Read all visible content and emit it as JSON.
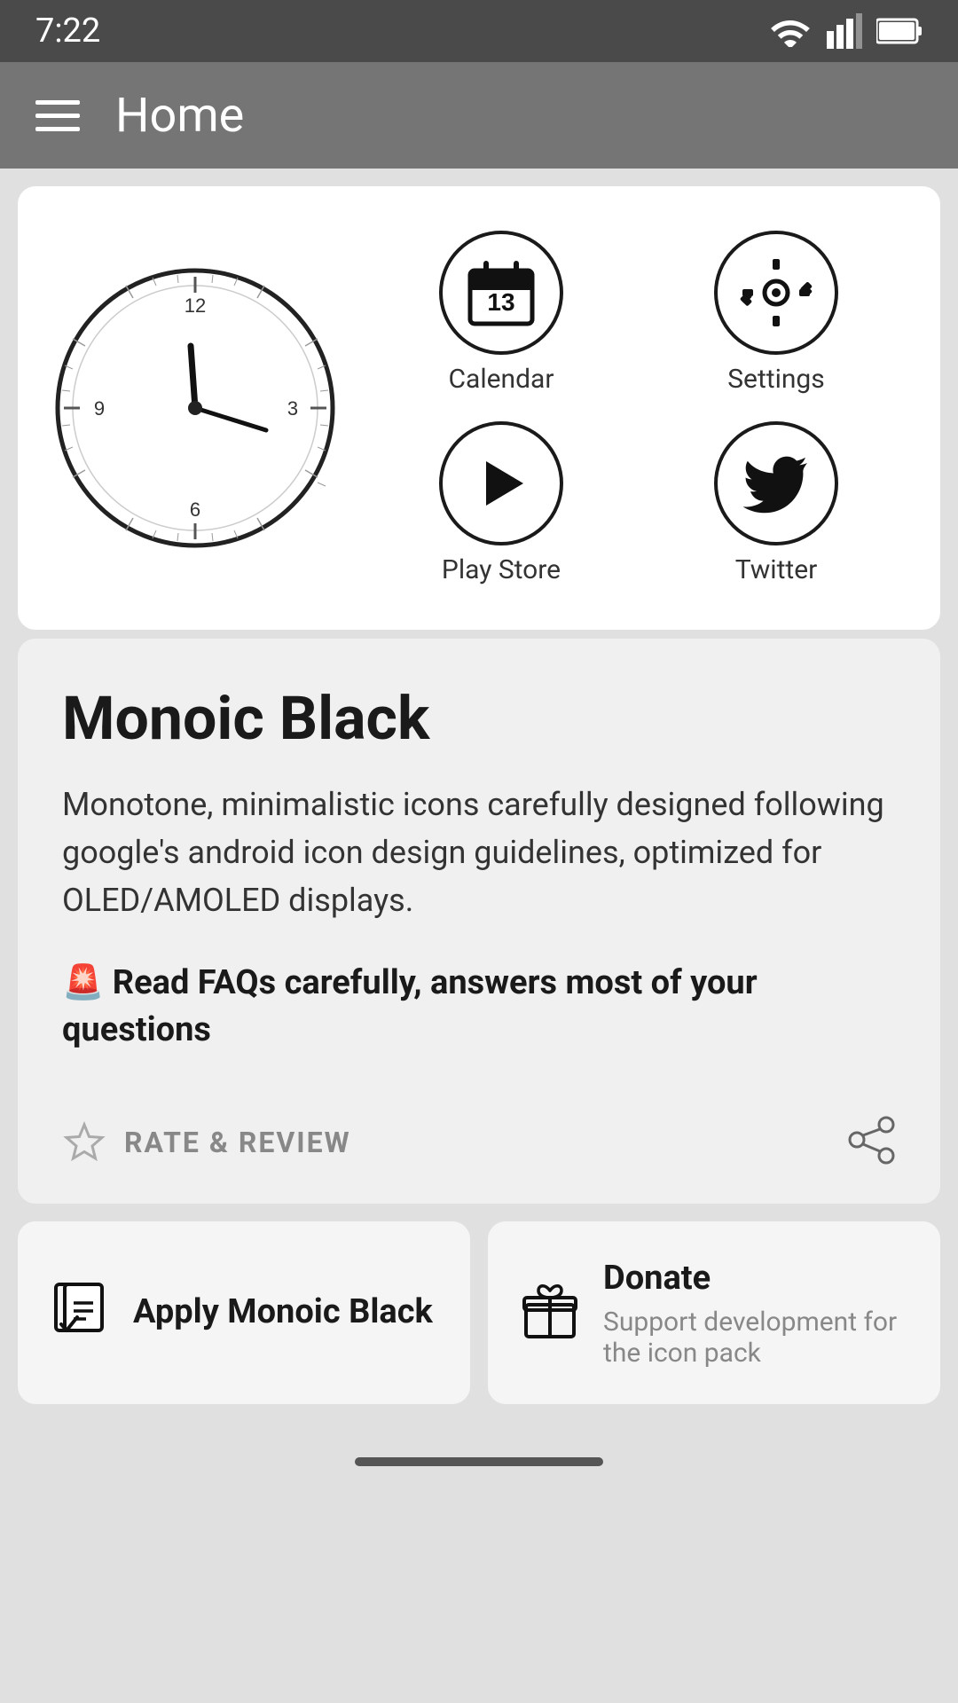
{
  "status": {
    "time": "7:22"
  },
  "topbar": {
    "title": "Home"
  },
  "preview": {
    "app_icons": [
      {
        "id": "calendar",
        "label": "Calendar"
      },
      {
        "id": "settings",
        "label": "Settings"
      },
      {
        "id": "play-store",
        "label": "Play Store"
      },
      {
        "id": "twitter",
        "label": "Twitter"
      }
    ]
  },
  "info": {
    "title": "Monoic Black",
    "description": "Monotone, minimalistic icons carefully designed following google's android icon design guidelines, optimized for OLED/AMOLED displays.",
    "faq": "🚨 Read FAQs carefully, answers most of your questions",
    "rate_label": "RATE & REVIEW"
  },
  "actions": {
    "apply": {
      "title": "Apply Monoic Black"
    },
    "donate": {
      "title": "Donate",
      "subtitle": "Support development for the icon pack"
    }
  }
}
